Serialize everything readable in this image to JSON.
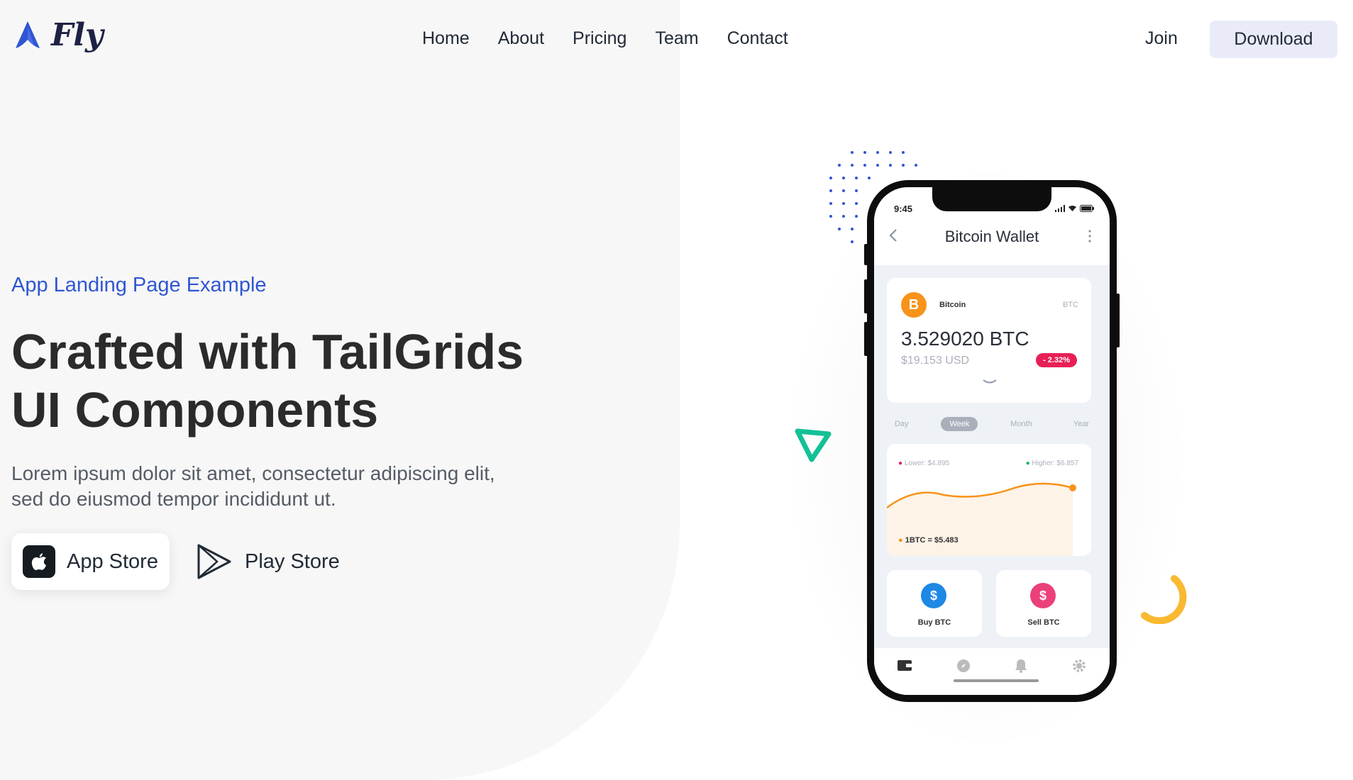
{
  "header": {
    "logo_text": "Fly",
    "nav": [
      "Home",
      "About",
      "Pricing",
      "Team",
      "Contact"
    ],
    "join_label": "Join",
    "download_label": "Download"
  },
  "hero": {
    "tag": "App Landing Page Example",
    "title_line1": "Crafted with TailGrids",
    "title_line2": "UI Components",
    "desc_line1": "Lorem ipsum dolor sit amet, consectetur adipiscing elit,",
    "desc_line2": "sed do eiusmod tempor incididunt ut.",
    "app_store": "App Store",
    "play_store": "Play Store"
  },
  "phone": {
    "time": "9:45",
    "title": "Bitcoin Wallet",
    "coin_name": "Bitcoin",
    "coin_symbol": "BTC",
    "coin_glyph": "B",
    "balance": "3.529020 BTC",
    "usd": "$19.153 USD",
    "change": "- 2.32%",
    "tabs": [
      "Day",
      "Week",
      "Month",
      "Year"
    ],
    "active_tab": "Week",
    "low": "Lower: $4.895",
    "high": "Higher: $6.857",
    "rate": "1BTC = $5.483",
    "buy_label": "Buy BTC",
    "sell_label": "Sell BTC",
    "dollar_glyph": "$"
  },
  "colors": {
    "accent": "#3056d3",
    "left_bg": "#f7f7f7",
    "download_bg": "#e9ecf8",
    "bitcoin": "#f7931a",
    "negative": "#e81f56",
    "positive": "#1bb55c",
    "buy": "#1e88e5",
    "sell": "#ec407a",
    "triangle": "#13c296",
    "arc": "#f9b931"
  },
  "icons": [
    "logo-icon",
    "apple-icon",
    "play-icon",
    "back-icon",
    "more-icon",
    "signal-icon",
    "wifi-icon",
    "battery-icon",
    "chevron-down-icon",
    "wallet-icon",
    "compass-icon",
    "bell-icon",
    "gear-icon"
  ]
}
